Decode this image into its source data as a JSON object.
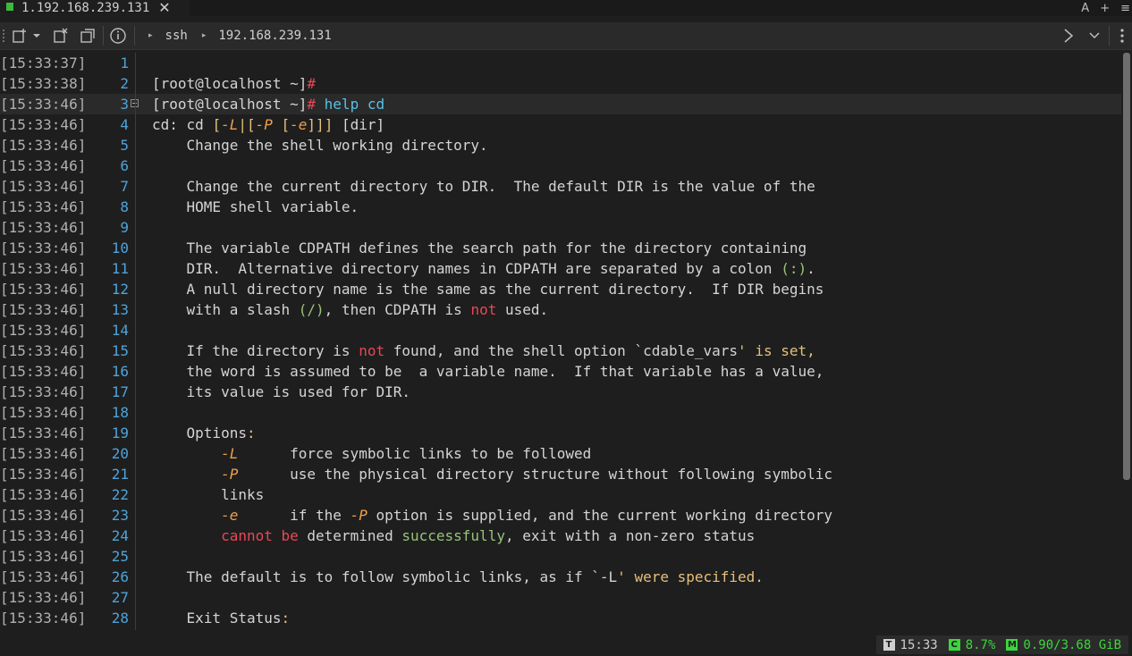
{
  "tab": {
    "title": "1.192.168.239.131",
    "close": "✕",
    "dot_color": "#3cba3c"
  },
  "tabbar_right": {
    "font": "A",
    "add": "+",
    "menu": "≡"
  },
  "toolbar": {
    "breadcrumb": [
      {
        "arrow": "▸",
        "label": "ssh"
      },
      {
        "arrow": "▸",
        "label": "192.168.239.131"
      }
    ],
    "icons": [
      "new-tab-icon",
      "dropdown-icon",
      "close-tab-icon",
      "duplicate-icon",
      "info-icon",
      "chevron-right-icon",
      "chevron-down-icon",
      "more-vertical-icon"
    ]
  },
  "lines": [
    {
      "ts": "[15:33:37]",
      "num": "1",
      "segs": []
    },
    {
      "ts": "[15:33:38]",
      "num": "2",
      "segs": [
        [
          "[root@localhost ~]",
          "def"
        ],
        [
          "#",
          "red"
        ]
      ]
    },
    {
      "ts": "[15:33:46]",
      "num": "3",
      "fold": true,
      "current": true,
      "segs": [
        [
          "[root@localhost ~]",
          "def"
        ],
        [
          "#",
          "red"
        ],
        [
          " help cd",
          "cyan"
        ]
      ]
    },
    {
      "ts": "[15:33:46]",
      "num": "4",
      "segs": [
        [
          "cd: cd ",
          "def"
        ],
        [
          "[",
          "yel"
        ],
        [
          "-L",
          "ital"
        ],
        [
          "|",
          "yel"
        ],
        [
          "[",
          "yel"
        ],
        [
          "-P",
          "ital"
        ],
        [
          " [",
          "yel"
        ],
        [
          "-e",
          "ital"
        ],
        [
          "]]]",
          "yel"
        ],
        [
          " [dir]",
          "def"
        ]
      ]
    },
    {
      "ts": "[15:33:46]",
      "num": "5",
      "segs": [
        [
          "    Change the shell working directory.",
          "def"
        ]
      ]
    },
    {
      "ts": "[15:33:46]",
      "num": "6",
      "segs": []
    },
    {
      "ts": "[15:33:46]",
      "num": "7",
      "segs": [
        [
          "    Change the current directory to DIR.  The default DIR is the value of the",
          "def"
        ]
      ]
    },
    {
      "ts": "[15:33:46]",
      "num": "8",
      "segs": [
        [
          "    HOME shell variable.",
          "def"
        ]
      ]
    },
    {
      "ts": "[15:33:46]",
      "num": "9",
      "segs": []
    },
    {
      "ts": "[15:33:46]",
      "num": "10",
      "segs": [
        [
          "    The variable CDPATH defines the search path for the directory containing",
          "def"
        ]
      ]
    },
    {
      "ts": "[15:33:46]",
      "num": "11",
      "segs": [
        [
          "    DIR.  Alternative directory names in CDPATH are separated by a colon ",
          "def"
        ],
        [
          "(:)",
          "grn"
        ],
        [
          ".",
          "def"
        ]
      ]
    },
    {
      "ts": "[15:33:46]",
      "num": "12",
      "segs": [
        [
          "    A null directory name is the same as the current directory.  If DIR begins",
          "def"
        ]
      ]
    },
    {
      "ts": "[15:33:46]",
      "num": "13",
      "segs": [
        [
          "    with a slash ",
          "def"
        ],
        [
          "(/)",
          "grn"
        ],
        [
          ", then CDPATH is ",
          "def"
        ],
        [
          "not",
          "red"
        ],
        [
          " used.",
          "def"
        ]
      ]
    },
    {
      "ts": "[15:33:46]",
      "num": "14",
      "segs": []
    },
    {
      "ts": "[15:33:46]",
      "num": "15",
      "segs": [
        [
          "    If the directory is ",
          "def"
        ],
        [
          "not",
          "red"
        ],
        [
          " found, and the shell option `cdable_vars",
          "def"
        ],
        [
          "' is set,",
          "yel"
        ]
      ]
    },
    {
      "ts": "[15:33:46]",
      "num": "16",
      "segs": [
        [
          "    the word is assumed to be  a variable name.  If that variable has a value,",
          "def"
        ]
      ]
    },
    {
      "ts": "[15:33:46]",
      "num": "17",
      "segs": [
        [
          "    its value is used for DIR.",
          "def"
        ]
      ]
    },
    {
      "ts": "[15:33:46]",
      "num": "18",
      "segs": []
    },
    {
      "ts": "[15:33:46]",
      "num": "19",
      "segs": [
        [
          "    Options",
          "def"
        ],
        [
          ":",
          "yel"
        ]
      ]
    },
    {
      "ts": "[15:33:46]",
      "num": "20",
      "segs": [
        [
          "        ",
          "def"
        ],
        [
          "-L",
          "ital"
        ],
        [
          "      force symbolic links to be followed",
          "def"
        ]
      ]
    },
    {
      "ts": "[15:33:46]",
      "num": "21",
      "segs": [
        [
          "        ",
          "def"
        ],
        [
          "-P",
          "ital"
        ],
        [
          "      use the physical directory structure without following symbolic",
          "def"
        ]
      ]
    },
    {
      "ts": "[15:33:46]",
      "num": "22",
      "segs": [
        [
          "        links",
          "def"
        ]
      ]
    },
    {
      "ts": "[15:33:46]",
      "num": "23",
      "segs": [
        [
          "        ",
          "def"
        ],
        [
          "-e",
          "ital"
        ],
        [
          "      if the ",
          "def"
        ],
        [
          "-P",
          "ital"
        ],
        [
          " option is supplied, and the current working directory",
          "def"
        ]
      ]
    },
    {
      "ts": "[15:33:46]",
      "num": "24",
      "segs": [
        [
          "        ",
          "def"
        ],
        [
          "cannot be",
          "red"
        ],
        [
          " determined ",
          "def"
        ],
        [
          "successfully",
          "grn"
        ],
        [
          ", exit with a non-zero status",
          "def"
        ]
      ]
    },
    {
      "ts": "[15:33:46]",
      "num": "25",
      "segs": []
    },
    {
      "ts": "[15:33:46]",
      "num": "26",
      "segs": [
        [
          "    The default is to follow symbolic links, as if `-L",
          "def"
        ],
        [
          "' were specified.",
          "yel"
        ]
      ]
    },
    {
      "ts": "[15:33:46]",
      "num": "27",
      "segs": []
    },
    {
      "ts": "[15:33:46]",
      "num": "28",
      "segs": [
        [
          "    Exit Status",
          "def"
        ],
        [
          ":",
          "yel"
        ]
      ]
    }
  ],
  "status": {
    "t_badge": "T",
    "time": "15:33",
    "c_badge": "C",
    "cpu": "8.7%",
    "m_badge": "M",
    "mem": "0.90/3.68 GiB"
  }
}
